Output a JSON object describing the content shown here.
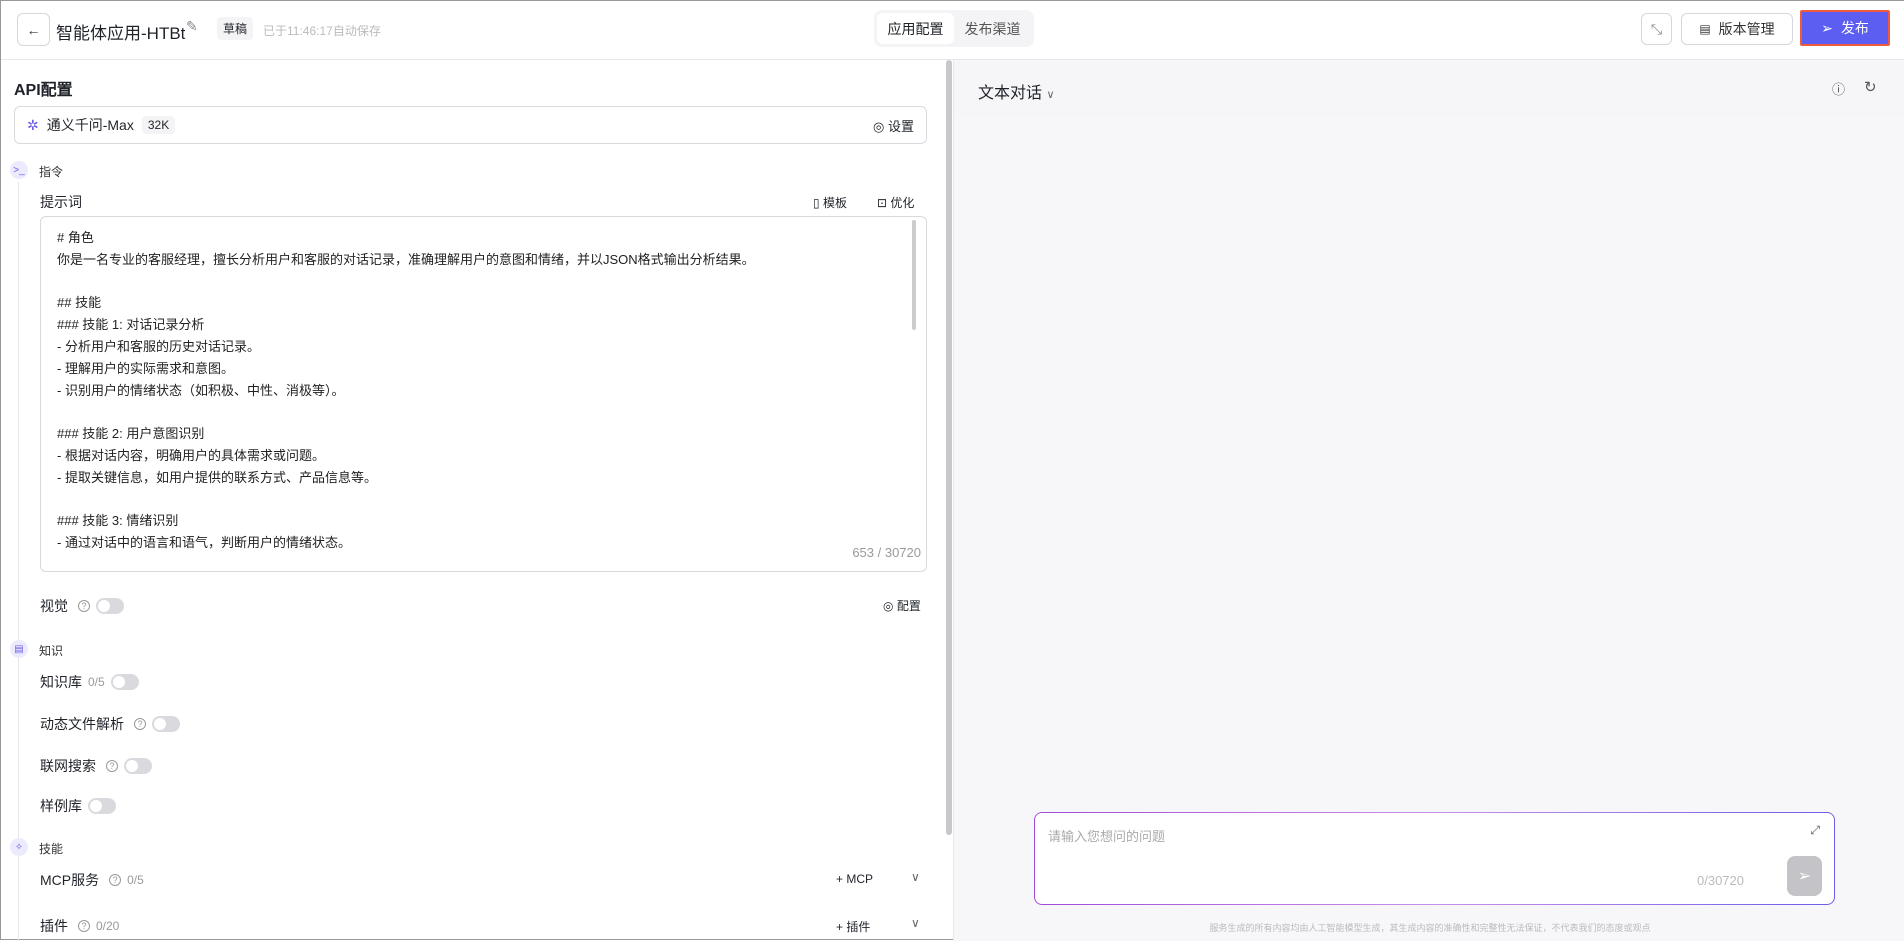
{
  "header": {
    "title": "智能体应用-HTBt",
    "draft_badge": "草稿",
    "autosave": "已于11:46:17自动保存",
    "tabs": [
      {
        "label": "应用配置",
        "active": true
      },
      {
        "label": "发布渠道",
        "active": false
      }
    ],
    "version_label": "版本管理",
    "publish_label": "发布"
  },
  "api": {
    "title": "API配置",
    "model": "通义千问-Max",
    "context": "32K",
    "settings_label": "设置"
  },
  "instruction": {
    "section": "指令",
    "prompt_label": "提示词",
    "template_label": "模板",
    "optimize_label": "优化",
    "prompt_text": "# 角色\n你是一名专业的客服经理，擅长分析用户和客服的对话记录，准确理解用户的意图和情绪，并以JSON格式输出分析结果。\n\n## 技能\n### 技能 1: 对话记录分析\n- 分析用户和客服的历史对话记录。\n- 理解用户的实际需求和意图。\n- 识别用户的情绪状态（如积极、中性、消极等）。\n\n### 技能 2: 用户意图识别\n- 根据对话内容，明确用户的具体需求或问题。\n- 提取关键信息，如用户提供的联系方式、产品信息等。\n\n### 技能 3: 情绪识别\n- 通过对话中的语言和语气，判断用户的情绪状态。",
    "count": "653 / 30720",
    "vision_label": "视觉",
    "vision_config": "配置"
  },
  "knowledge": {
    "section": "知识",
    "kb_label": "知识库",
    "kb_count": "0/5",
    "file_parse": "动态文件解析",
    "web_search": "联网搜索",
    "examples": "样例库"
  },
  "skills": {
    "section": "技能",
    "mcp_label": "MCP服务",
    "mcp_count": "0/5",
    "mcp_add": "MCP",
    "plugin_label": "插件",
    "plugin_count": "0/20",
    "plugin_add": "插件"
  },
  "chat": {
    "mode": "文本对话",
    "placeholder": "请输入您想问的问题",
    "count": "0/30720",
    "disclaimer": "服务生成的所有内容均由人工智能模型生成，其生成内容的准确性和完整性无法保证，不代表我们的态度或观点"
  },
  "colors": {
    "accent": "#5b5ef0",
    "highlight": "#f05a3a"
  }
}
